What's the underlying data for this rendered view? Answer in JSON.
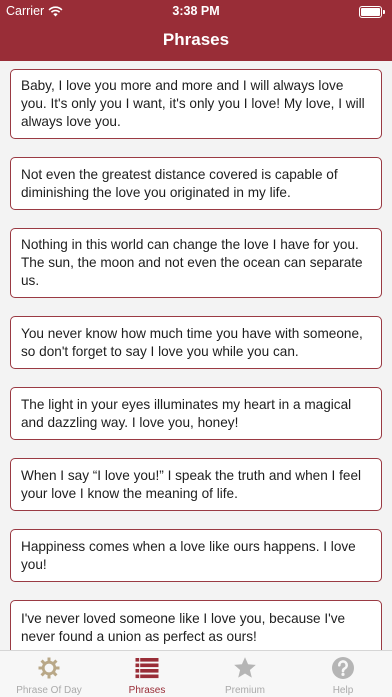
{
  "status_bar": {
    "carrier": "Carrier",
    "time": "3:38 PM"
  },
  "nav": {
    "title": "Phrases"
  },
  "phrases": [
    "Baby, I love you more and more and I will always love you. It's only you I want, it's only you I love! My love, I will always love you.",
    "Not even the greatest distance covered is capable of diminishing the love you originated in my life.",
    "Nothing in this world can change the love I have for you. The sun, the moon and not even the ocean can separate us.",
    "You never know how much time you have with someone, so don't forget to say I love you while you can.",
    "The light in your eyes illuminates my heart in a magical and dazzling way. I love you, honey!",
    "When I say “I love you!” I speak the truth and when I feel your love I know the meaning of life.",
    "Happiness comes when a love like ours happens. I love you!",
    "I've never loved someone like I love you, because I've never found a union as perfect as ours!"
  ],
  "tabs": [
    {
      "label": "Phrase Of Day",
      "icon": "sun-gear-icon"
    },
    {
      "label": "Phrases",
      "icon": "list-icon",
      "active": true
    },
    {
      "label": "Premium",
      "icon": "star-icon"
    },
    {
      "label": "Help",
      "icon": "question-icon"
    }
  ],
  "colors": {
    "accent": "#992d37",
    "inactive": "#aaaaaa",
    "background": "#f3f3f3"
  }
}
